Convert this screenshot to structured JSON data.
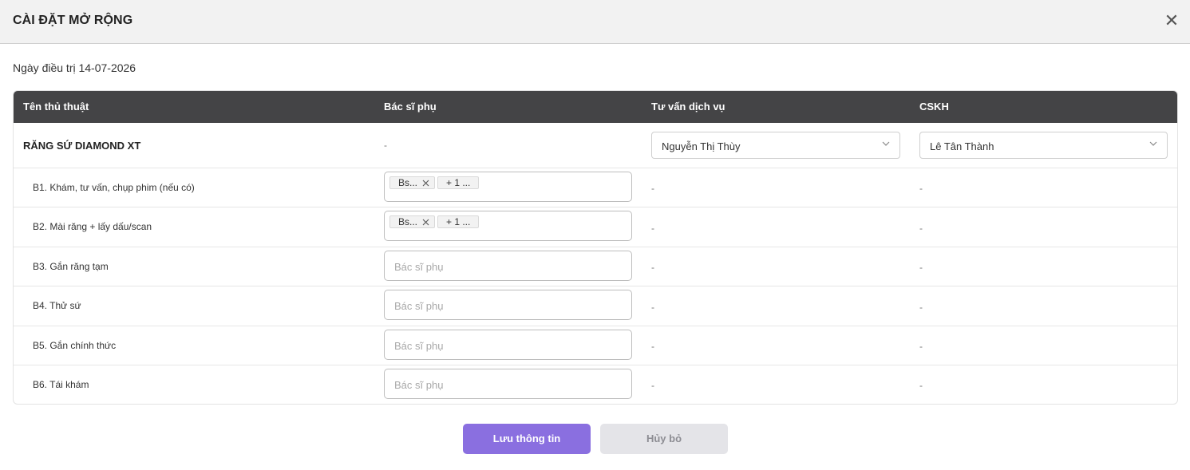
{
  "header": {
    "title": "CÀI ĐẶT MỞ RỘNG",
    "close_icon": "close-icon"
  },
  "treatment_date": "Ngày điều trị 14-07-2026",
  "table": {
    "columns": [
      "Tên thủ thuật",
      "Bác sĩ phụ",
      "Tư vấn dịch vụ",
      "CSKH"
    ],
    "main_row": {
      "procedure": "RĂNG SỨ DIAMOND XT",
      "assistant": "-",
      "consultant": "Nguyễn Thị Thùy",
      "cskh": "Lê Tân Thành"
    },
    "steps": [
      {
        "name": "B1. Khám, tư vấn, chụp phim (nếu có)",
        "tags": [
          "Bs...",
          "+ 1 ..."
        ],
        "placeholder": "",
        "consultant": "-",
        "cskh": "-"
      },
      {
        "name": "B2. Mài răng + lấy dấu/scan",
        "tags": [
          "Bs...",
          "+ 1 ..."
        ],
        "placeholder": "",
        "consultant": "-",
        "cskh": "-"
      },
      {
        "name": "B3. Gắn răng tạm",
        "tags": [],
        "placeholder": "Bác sĩ phụ",
        "consultant": "-",
        "cskh": "-"
      },
      {
        "name": "B4. Thử sứ",
        "tags": [],
        "placeholder": "Bác sĩ phụ",
        "consultant": "-",
        "cskh": "-"
      },
      {
        "name": "B5. Gắn chính thức",
        "tags": [],
        "placeholder": "Bác sĩ phụ",
        "consultant": "-",
        "cskh": "-"
      },
      {
        "name": "B6. Tái khám",
        "tags": [],
        "placeholder": "Bác sĩ phụ",
        "consultant": "-",
        "cskh": "-"
      }
    ]
  },
  "buttons": {
    "save": "Lưu thông tin",
    "cancel": "Hủy bỏ"
  },
  "colors": {
    "header_bg": "#444446",
    "primary": "#8a6fe0",
    "cancel_bg": "#e4e4e8"
  }
}
